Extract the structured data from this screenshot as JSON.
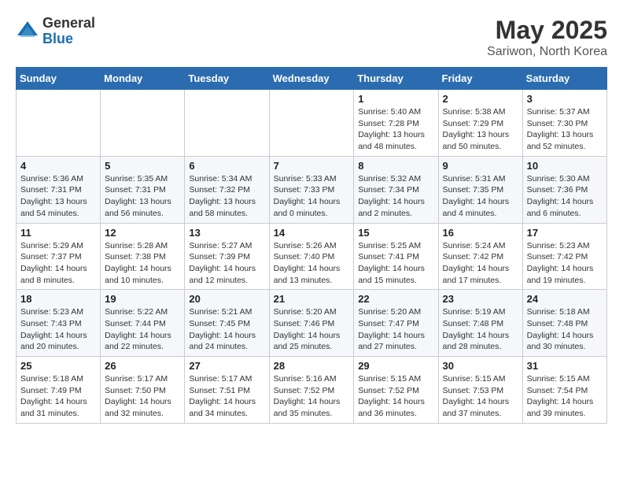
{
  "logo": {
    "general": "General",
    "blue": "Blue"
  },
  "title": "May 2025",
  "subtitle": "Sariwon, North Korea",
  "days_of_week": [
    "Sunday",
    "Monday",
    "Tuesday",
    "Wednesday",
    "Thursday",
    "Friday",
    "Saturday"
  ],
  "weeks": [
    [
      {
        "day": "",
        "info": ""
      },
      {
        "day": "",
        "info": ""
      },
      {
        "day": "",
        "info": ""
      },
      {
        "day": "",
        "info": ""
      },
      {
        "day": "1",
        "info": "Sunrise: 5:40 AM\nSunset: 7:28 PM\nDaylight: 13 hours\nand 48 minutes."
      },
      {
        "day": "2",
        "info": "Sunrise: 5:38 AM\nSunset: 7:29 PM\nDaylight: 13 hours\nand 50 minutes."
      },
      {
        "day": "3",
        "info": "Sunrise: 5:37 AM\nSunset: 7:30 PM\nDaylight: 13 hours\nand 52 minutes."
      }
    ],
    [
      {
        "day": "4",
        "info": "Sunrise: 5:36 AM\nSunset: 7:31 PM\nDaylight: 13 hours\nand 54 minutes."
      },
      {
        "day": "5",
        "info": "Sunrise: 5:35 AM\nSunset: 7:31 PM\nDaylight: 13 hours\nand 56 minutes."
      },
      {
        "day": "6",
        "info": "Sunrise: 5:34 AM\nSunset: 7:32 PM\nDaylight: 13 hours\nand 58 minutes."
      },
      {
        "day": "7",
        "info": "Sunrise: 5:33 AM\nSunset: 7:33 PM\nDaylight: 14 hours\nand 0 minutes."
      },
      {
        "day": "8",
        "info": "Sunrise: 5:32 AM\nSunset: 7:34 PM\nDaylight: 14 hours\nand 2 minutes."
      },
      {
        "day": "9",
        "info": "Sunrise: 5:31 AM\nSunset: 7:35 PM\nDaylight: 14 hours\nand 4 minutes."
      },
      {
        "day": "10",
        "info": "Sunrise: 5:30 AM\nSunset: 7:36 PM\nDaylight: 14 hours\nand 6 minutes."
      }
    ],
    [
      {
        "day": "11",
        "info": "Sunrise: 5:29 AM\nSunset: 7:37 PM\nDaylight: 14 hours\nand 8 minutes."
      },
      {
        "day": "12",
        "info": "Sunrise: 5:28 AM\nSunset: 7:38 PM\nDaylight: 14 hours\nand 10 minutes."
      },
      {
        "day": "13",
        "info": "Sunrise: 5:27 AM\nSunset: 7:39 PM\nDaylight: 14 hours\nand 12 minutes."
      },
      {
        "day": "14",
        "info": "Sunrise: 5:26 AM\nSunset: 7:40 PM\nDaylight: 14 hours\nand 13 minutes."
      },
      {
        "day": "15",
        "info": "Sunrise: 5:25 AM\nSunset: 7:41 PM\nDaylight: 14 hours\nand 15 minutes."
      },
      {
        "day": "16",
        "info": "Sunrise: 5:24 AM\nSunset: 7:42 PM\nDaylight: 14 hours\nand 17 minutes."
      },
      {
        "day": "17",
        "info": "Sunrise: 5:23 AM\nSunset: 7:42 PM\nDaylight: 14 hours\nand 19 minutes."
      }
    ],
    [
      {
        "day": "18",
        "info": "Sunrise: 5:23 AM\nSunset: 7:43 PM\nDaylight: 14 hours\nand 20 minutes."
      },
      {
        "day": "19",
        "info": "Sunrise: 5:22 AM\nSunset: 7:44 PM\nDaylight: 14 hours\nand 22 minutes."
      },
      {
        "day": "20",
        "info": "Sunrise: 5:21 AM\nSunset: 7:45 PM\nDaylight: 14 hours\nand 24 minutes."
      },
      {
        "day": "21",
        "info": "Sunrise: 5:20 AM\nSunset: 7:46 PM\nDaylight: 14 hours\nand 25 minutes."
      },
      {
        "day": "22",
        "info": "Sunrise: 5:20 AM\nSunset: 7:47 PM\nDaylight: 14 hours\nand 27 minutes."
      },
      {
        "day": "23",
        "info": "Sunrise: 5:19 AM\nSunset: 7:48 PM\nDaylight: 14 hours\nand 28 minutes."
      },
      {
        "day": "24",
        "info": "Sunrise: 5:18 AM\nSunset: 7:48 PM\nDaylight: 14 hours\nand 30 minutes."
      }
    ],
    [
      {
        "day": "25",
        "info": "Sunrise: 5:18 AM\nSunset: 7:49 PM\nDaylight: 14 hours\nand 31 minutes."
      },
      {
        "day": "26",
        "info": "Sunrise: 5:17 AM\nSunset: 7:50 PM\nDaylight: 14 hours\nand 32 minutes."
      },
      {
        "day": "27",
        "info": "Sunrise: 5:17 AM\nSunset: 7:51 PM\nDaylight: 14 hours\nand 34 minutes."
      },
      {
        "day": "28",
        "info": "Sunrise: 5:16 AM\nSunset: 7:52 PM\nDaylight: 14 hours\nand 35 minutes."
      },
      {
        "day": "29",
        "info": "Sunrise: 5:15 AM\nSunset: 7:52 PM\nDaylight: 14 hours\nand 36 minutes."
      },
      {
        "day": "30",
        "info": "Sunrise: 5:15 AM\nSunset: 7:53 PM\nDaylight: 14 hours\nand 37 minutes."
      },
      {
        "day": "31",
        "info": "Sunrise: 5:15 AM\nSunset: 7:54 PM\nDaylight: 14 hours\nand 39 minutes."
      }
    ]
  ]
}
